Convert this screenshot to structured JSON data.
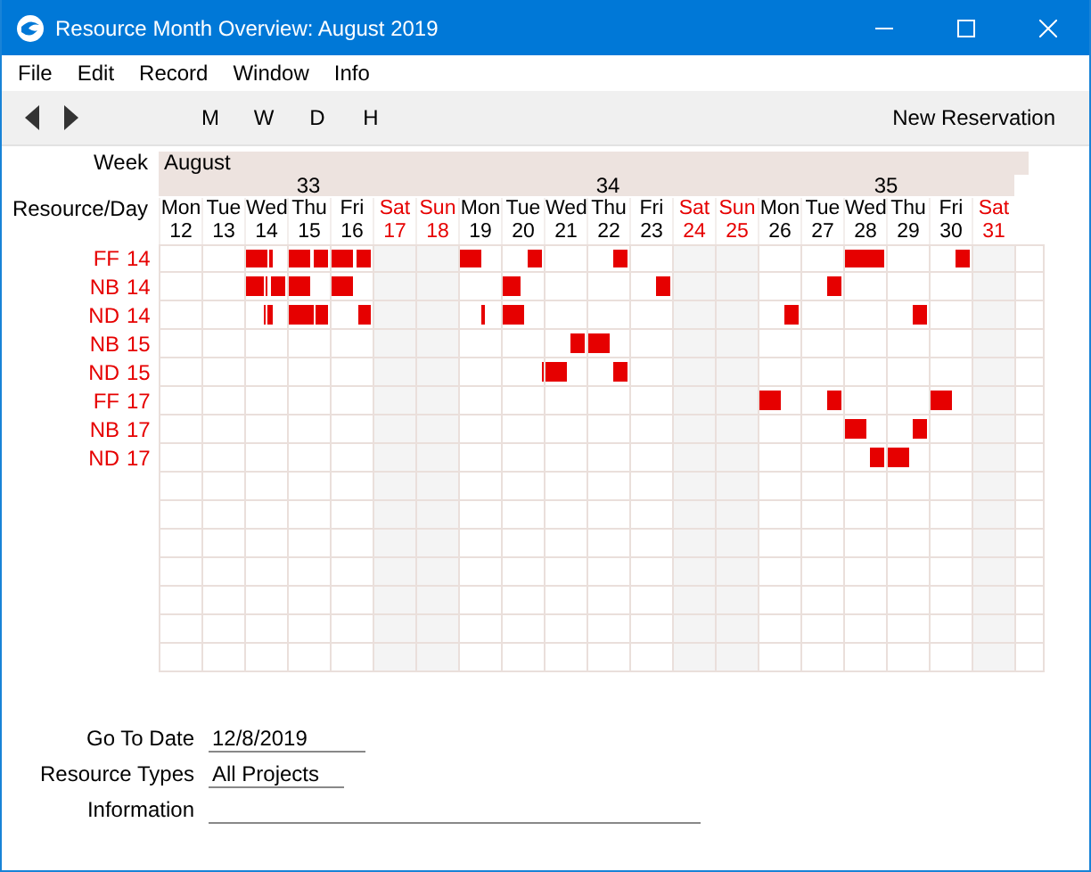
{
  "window": {
    "title": "Resource Month Overview: August 2019"
  },
  "menu": [
    "File",
    "Edit",
    "Record",
    "Window",
    "Info"
  ],
  "toolbar": {
    "views": [
      "M",
      "W",
      "D",
      "H"
    ],
    "action": "New Reservation"
  },
  "calendar": {
    "week_label": "Week",
    "day_label": "Resource/Day",
    "month": "August",
    "weeks": [
      {
        "label": "33",
        "days": [
          {
            "name": "Mon",
            "date": "12",
            "kind": "weekday"
          },
          {
            "name": "Tue",
            "date": "13",
            "kind": "weekday"
          },
          {
            "name": "Wed",
            "date": "14",
            "kind": "weekday"
          },
          {
            "name": "Thu",
            "date": "15",
            "kind": "weekday"
          },
          {
            "name": "Fri",
            "date": "16",
            "kind": "weekday"
          },
          {
            "name": "Sat",
            "date": "17",
            "kind": "weekend"
          },
          {
            "name": "Sun",
            "date": "18",
            "kind": "weekend"
          }
        ]
      },
      {
        "label": "34",
        "days": [
          {
            "name": "Mon",
            "date": "19",
            "kind": "weekday"
          },
          {
            "name": "Tue",
            "date": "20",
            "kind": "weekday"
          },
          {
            "name": "Wed",
            "date": "21",
            "kind": "weekday"
          },
          {
            "name": "Thu",
            "date": "22",
            "kind": "weekday"
          },
          {
            "name": "Fri",
            "date": "23",
            "kind": "weekday"
          },
          {
            "name": "Sat",
            "date": "24",
            "kind": "weekend"
          },
          {
            "name": "Sun",
            "date": "25",
            "kind": "weekend"
          }
        ]
      },
      {
        "label": "35",
        "days": [
          {
            "name": "Mon",
            "date": "26",
            "kind": "weekday"
          },
          {
            "name": "Tue",
            "date": "27",
            "kind": "weekday"
          },
          {
            "name": "Wed",
            "date": "28",
            "kind": "weekday"
          },
          {
            "name": "Thu",
            "date": "29",
            "kind": "weekday"
          },
          {
            "name": "Fri",
            "date": "30",
            "kind": "weekday"
          },
          {
            "name": "Sat",
            "date": "31",
            "kind": "weekend"
          }
        ]
      }
    ],
    "resources": [
      {
        "code": "FF",
        "number": "14",
        "bookings": {
          "14": [
            {
              "kind": "morning"
            },
            {
              "kind": "brief"
            }
          ],
          "15": [
            {
              "kind": "morning"
            },
            {
              "kind": "afternoon"
            }
          ],
          "16": [
            {
              "kind": "morning"
            },
            {
              "kind": "afternoon"
            }
          ],
          "19": [
            {
              "kind": "morning"
            }
          ],
          "20": [
            {
              "kind": "afternoon"
            }
          ],
          "22": [
            {
              "kind": "afternoon"
            }
          ],
          "28": [
            {
              "kind": "whole"
            }
          ],
          "30": [
            {
              "kind": "afternoon"
            }
          ]
        }
      },
      {
        "code": "NB",
        "number": "14",
        "bookings": {
          "14": [
            {
              "kind": "early"
            },
            {
              "kind": "forenoon"
            },
            {
              "kind": "afternoon"
            }
          ],
          "15": [
            {
              "kind": "morning"
            }
          ],
          "16": [
            {
              "kind": "morning"
            }
          ],
          "20": [
            {
              "kind": "early"
            }
          ],
          "23": [
            {
              "kind": "afternoon"
            }
          ],
          "27": [
            {
              "kind": "afternoon"
            }
          ]
        }
      },
      {
        "code": "ND",
        "number": "14",
        "bookings": {
          "14": [
            {
              "kind": "tick"
            },
            {
              "kind": "noon"
            },
            {
              "kind": "brief"
            }
          ],
          "15": [
            {
              "kind": "day"
            },
            {
              "kind": "evening"
            }
          ],
          "16": [
            {
              "kind": "evening"
            }
          ],
          "19": [
            {
              "kind": "midday"
            }
          ],
          "20": [
            {
              "kind": "morning"
            }
          ],
          "26": [
            {
              "kind": "afternoon"
            }
          ],
          "29": [
            {
              "kind": "afternoon"
            }
          ]
        }
      },
      {
        "code": "NB",
        "number": "15",
        "bookings": {
          "21": [
            {
              "kind": "afternoon"
            }
          ],
          "22": [
            {
              "kind": "morning"
            }
          ]
        }
      },
      {
        "code": "ND",
        "number": "15",
        "bookings": {
          "20": [
            {
              "kind": "night"
            }
          ],
          "21": [
            {
              "kind": "morning"
            }
          ],
          "22": [
            {
              "kind": "afternoon"
            }
          ]
        }
      },
      {
        "code": "FF",
        "number": "17",
        "bookings": {
          "26": [
            {
              "kind": "morning"
            }
          ],
          "27": [
            {
              "kind": "afternoon"
            }
          ],
          "30": [
            {
              "kind": "morning"
            }
          ]
        }
      },
      {
        "code": "NB",
        "number": "17",
        "bookings": {
          "28": [
            {
              "kind": "morning"
            }
          ],
          "29": [
            {
              "kind": "afternoon"
            }
          ]
        }
      },
      {
        "code": "ND",
        "number": "17",
        "bookings": {
          "28": [
            {
              "kind": "afternoon"
            }
          ],
          "29": [
            {
              "kind": "morning"
            }
          ]
        }
      }
    ]
  },
  "form": [
    {
      "label": "Go To Date",
      "value": "12/8/2019"
    },
    {
      "label": "Resource Types",
      "value": "All Projects"
    },
    {
      "label": "Information"
    }
  ]
}
